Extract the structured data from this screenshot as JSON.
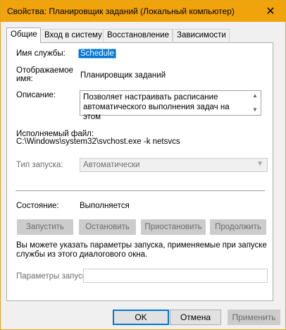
{
  "window": {
    "title": "Свойства: Планировщик заданий (Локальный компьютер)",
    "close_glyph": "✕"
  },
  "tabs": [
    {
      "label": "Общие",
      "active": true
    },
    {
      "label": "Вход в систему",
      "active": false
    },
    {
      "label": "Восстановление",
      "active": false
    },
    {
      "label": "Зависимости",
      "active": false
    }
  ],
  "general": {
    "service_name_label": "Имя службы:",
    "service_name_value": "Schedule",
    "display_name_label_1": "Отображаемое",
    "display_name_label_2": "имя:",
    "display_name_value": "Планировщик заданий",
    "description_label": "Описание:",
    "description_value": "Позволяет настраивать расписание автоматического выполнения задач на этом",
    "executable_label": "Исполняемый файл:",
    "executable_value": "C:\\Windows\\system32\\svchost.exe -k netsvcs",
    "startup_type_label": "Тип запуска:",
    "startup_type_value": "Автоматически",
    "status_label": "Состояние:",
    "status_value": "Выполняется",
    "buttons": {
      "start": "Запустить",
      "stop": "Остановить",
      "pause": "Приостановить",
      "resume": "Продолжить"
    },
    "hint_line_1": "Вы можете указать параметры запуска, применяемые при запуске",
    "hint_line_2": "службы из этого диалогового окна.",
    "start_params_label": "Параметры запуска:",
    "start_params_value": ""
  },
  "dialog_buttons": {
    "ok": "OK",
    "cancel": "Отмена",
    "apply": "Применить"
  },
  "colors": {
    "titlebar": "#f0a30a",
    "selection": "#0078d7",
    "disabled_text": "#6d6d6d"
  }
}
